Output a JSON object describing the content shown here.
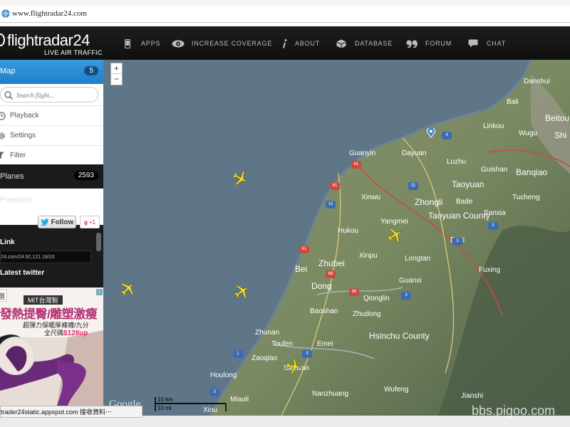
{
  "browser": {
    "url": "www.flightradar24.com"
  },
  "header": {
    "logo_name": "flightradar24",
    "logo_tagline": "LIVE AIR TRAFFIC",
    "nav": [
      {
        "label": "APPS",
        "icon": "phone-icon"
      },
      {
        "label": "INCREASE COVERAGE",
        "icon": "eye-icon"
      },
      {
        "label": "ABOUT",
        "icon": "info-icon"
      },
      {
        "label": "DATABASE",
        "icon": "database-icon"
      },
      {
        "label": "FORUM",
        "icon": "quote-icon"
      },
      {
        "label": "CHAT",
        "icon": "chat-bubble-icon"
      }
    ]
  },
  "sidebar": {
    "map_label": "Map",
    "map_count": "5",
    "search_placeholder": "Search flight...",
    "menu": [
      {
        "label": "Playback",
        "icon": "clock-icon"
      },
      {
        "label": "Settings",
        "icon": "gear-icon"
      },
      {
        "label": "Filter",
        "icon": "filter-icon"
      }
    ],
    "planes_label": "Planes",
    "planes_count": "2593",
    "premium_label": "Premium",
    "follow_label": "Follow",
    "gplus_label": "+1",
    "link_title": "Link",
    "link_value": "24.com/24.92,121.18/10",
    "twitter_title": "Latest twitter"
  },
  "ad": {
    "tag1": "選",
    "tag2": "MIT台灣製",
    "headline": "發熱提臀/雕塑激瘦",
    "subline": "超彈力保暖厚褲襪/九分",
    "price_prefix": "全尺碼",
    "price": "$128up"
  },
  "map": {
    "zoom_in": "+",
    "zoom_out": "−",
    "place_labels": [
      "Danshui",
      "Bali",
      "Beitou",
      "Linkou",
      "Wugu",
      "Shi",
      "Guanyin",
      "Dayuan",
      "Luzhu",
      "Guishan",
      "Banqiao",
      "Xinwu",
      "Zhongli",
      "Taoyuan",
      "Tucheng",
      "Bade",
      "Yangmei",
      "Taoyuan County",
      "Sanxia",
      "Hukou",
      "Daxi",
      "Xinpu",
      "Longtan",
      "Bei",
      "Zhubei",
      "Fuxing",
      "Dong",
      "Guanxi",
      "Qionglin",
      "Baoshan",
      "Zhudong",
      "Hsinchu County",
      "Zhunan",
      "Toufen",
      "Emei",
      "Zaoqiao",
      "Sanwan",
      "Houlong",
      "Wufeng",
      "Miaoli",
      "Nanzhuang",
      "Xinu",
      "Jianshi"
    ],
    "road_shields": [
      "4",
      "61",
      "61",
      "15",
      "31",
      "3",
      "61",
      "3",
      "66",
      "68",
      "3",
      "1",
      "3",
      "3"
    ],
    "scale_km": "10 km",
    "scale_mi": "10 mi",
    "attribution": "Google"
  },
  "status_bar": "trader24static.appspot.com 接收資料⋯",
  "watermark": "bbs.pigoo.com",
  "colors": {
    "header_bg": "#141414",
    "map_tab": "#2a8bd4",
    "sea": "#5e7688",
    "plane": "#f4e02a"
  }
}
